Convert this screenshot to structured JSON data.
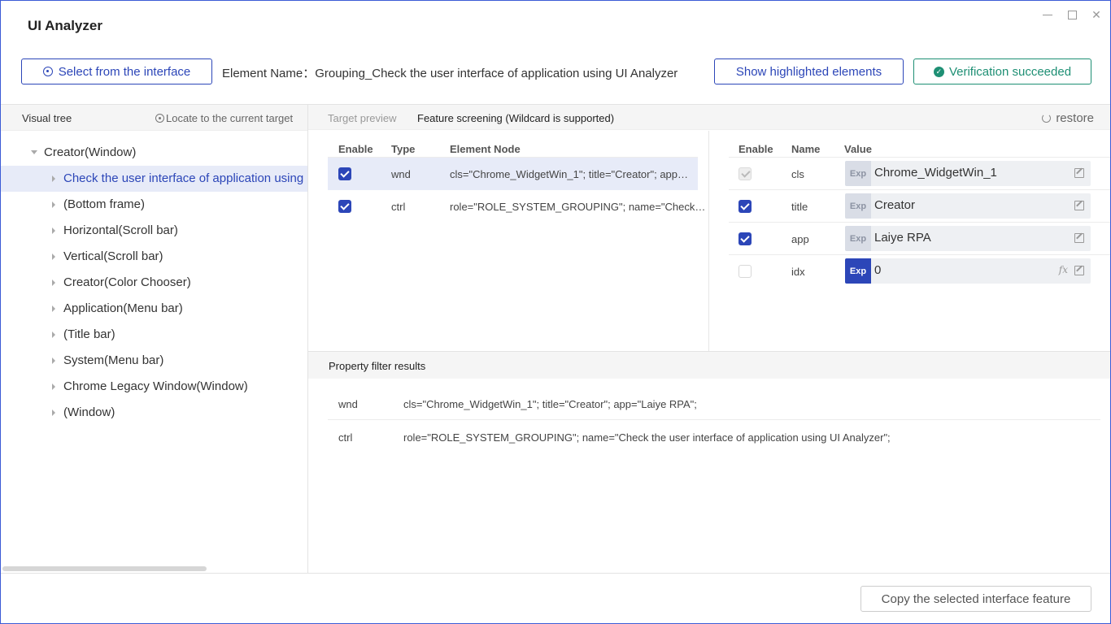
{
  "app": {
    "title": "UI Analyzer"
  },
  "toolbar": {
    "select_label": "Select from the interface",
    "element_name": "Element Name：Grouping_Check the user interface of application using UI Analyzer",
    "show_label": "Show highlighted elements",
    "verify_label": "Verification succeeded"
  },
  "left": {
    "header": "Visual tree",
    "locate_label": "Locate to the current target",
    "tree": [
      {
        "label": "Creator(Window)",
        "level": 0,
        "expanded": true
      },
      {
        "label": "Check the user interface of application using UI Analyzer",
        "level": 1,
        "selected": true
      },
      {
        "label": "(Bottom frame)",
        "level": 1
      },
      {
        "label": "Horizontal(Scroll bar)",
        "level": 1
      },
      {
        "label": "Vertical(Scroll bar)",
        "level": 1
      },
      {
        "label": "Creator(Color Chooser)",
        "level": 1
      },
      {
        "label": "Application(Menu bar)",
        "level": 1
      },
      {
        "label": "(Title bar)",
        "level": 1
      },
      {
        "label": "System(Menu bar)",
        "level": 1
      },
      {
        "label": "Chrome Legacy Window(Window)",
        "level": 1
      },
      {
        "label": "(Window)",
        "level": 1
      }
    ]
  },
  "tabs": {
    "preview": "Target preview",
    "screening": "Feature screening (Wildcard is supported)",
    "restore": "restore"
  },
  "nodes": {
    "headers": {
      "enable": "Enable",
      "type": "Type",
      "node": "Element Node"
    },
    "rows": [
      {
        "type": "wnd",
        "node": "cls=\"Chrome_WidgetWin_1\"; title=\"Creator\"; app…",
        "enabled": true,
        "selected": true
      },
      {
        "type": "ctrl",
        "node": "role=\"ROLE_SYSTEM_GROUPING\"; name=\"Check…",
        "enabled": true
      }
    ]
  },
  "attrs": {
    "headers": {
      "enable": "Enable",
      "name": "Name",
      "value": "Value"
    },
    "exp_label": "Exp",
    "fx_label": "fx",
    "rows": [
      {
        "name": "cls",
        "value": "Chrome_WidgetWin_1",
        "state": "disabled"
      },
      {
        "name": "title",
        "value": "Creator",
        "state": "on"
      },
      {
        "name": "app",
        "value": "Laiye RPA",
        "state": "on"
      },
      {
        "name": "idx",
        "value": "0",
        "state": "off",
        "exp_active": true
      }
    ]
  },
  "filter": {
    "title": "Property filter results",
    "rows": [
      {
        "type": "wnd",
        "value": "cls=\"Chrome_WidgetWin_1\"; title=\"Creator\"; app=\"Laiye RPA\";"
      },
      {
        "type": "ctrl",
        "value": "role=\"ROLE_SYSTEM_GROUPING\"; name=\"Check the user interface of application using UI Analyzer\";"
      }
    ]
  },
  "footer": {
    "copy_label": "Copy the selected interface feature"
  },
  "colors": {
    "accent": "#2c46b8",
    "success": "#1e8f74",
    "selected_bg": "#e7ebf8"
  }
}
